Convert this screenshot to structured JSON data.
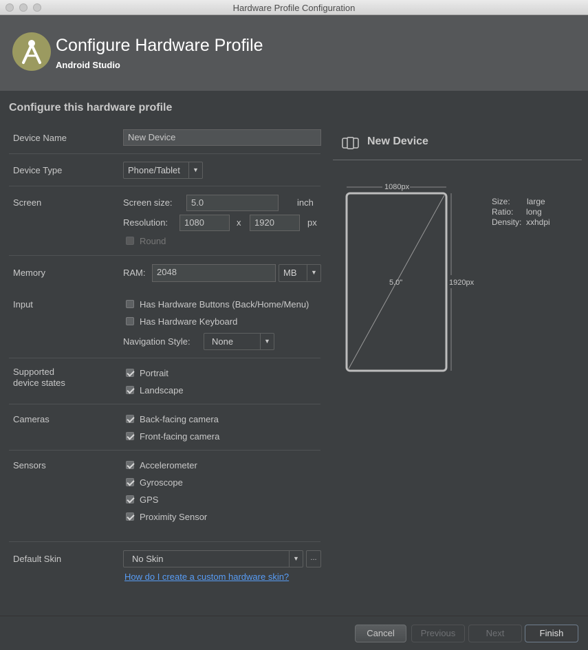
{
  "window": {
    "title": "Hardware Profile Configuration"
  },
  "header": {
    "title": "Configure Hardware Profile",
    "subtitle": "Android Studio"
  },
  "section_title": "Configure this hardware profile",
  "form": {
    "device_name": {
      "label": "Device Name",
      "value": "New Device"
    },
    "device_type": {
      "label": "Device Type",
      "value": "Phone/Tablet"
    },
    "screen": {
      "label": "Screen",
      "size_label": "Screen size:",
      "size_value": "5.0",
      "size_unit": "inch",
      "resolution_label": "Resolution:",
      "res_width": "1080",
      "res_x": "x",
      "res_height": "1920",
      "res_unit": "px",
      "round_label": "Round"
    },
    "memory": {
      "label": "Memory",
      "ram_label": "RAM:",
      "ram_value": "2048",
      "ram_unit": "MB"
    },
    "input": {
      "label": "Input",
      "hw_buttons": "Has Hardware Buttons (Back/Home/Menu)",
      "hw_keyboard": "Has Hardware Keyboard",
      "nav_style_label": "Navigation Style:",
      "nav_style_value": "None"
    },
    "states": {
      "label_line1": "Supported",
      "label_line2": "device states",
      "portrait": "Portrait",
      "landscape": "Landscape"
    },
    "cameras": {
      "label": "Cameras",
      "back": "Back-facing camera",
      "front": "Front-facing camera"
    },
    "sensors": {
      "label": "Sensors",
      "accelerometer": "Accelerometer",
      "gyroscope": "Gyroscope",
      "gps": "GPS",
      "proximity": "Proximity Sensor"
    },
    "skin": {
      "label": "Default Skin",
      "value": "No Skin",
      "more": "...",
      "help_link": "How do I create a custom hardware skin?"
    }
  },
  "preview": {
    "title": "New Device",
    "width_label": "1080px",
    "height_label": "1920px",
    "diagonal_label": "5.0\"",
    "size_key": "Size:",
    "size_val": "large",
    "ratio_key": "Ratio:",
    "ratio_val": "long",
    "density_key": "Density:",
    "density_val": "xxhdpi"
  },
  "footer": {
    "cancel": "Cancel",
    "previous": "Previous",
    "next": "Next",
    "finish": "Finish"
  },
  "colors": {
    "background": "#3c3f41",
    "banner": "#555759",
    "link": "#589df6",
    "logo": "#9b9a60"
  }
}
